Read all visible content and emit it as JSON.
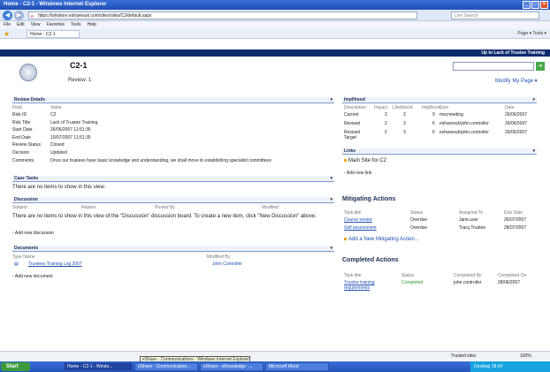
{
  "window": {
    "title": "Home - C2-1 - Windows Internet Explorer",
    "url": "https://ishistore.esharesuk.com/sites/risks/C2/default.aspx",
    "search_placeholder": "Live Search"
  },
  "menu": [
    "File",
    "Edit",
    "View",
    "Favorites",
    "Tools",
    "Help"
  ],
  "tab": {
    "label": "Home - C2-1"
  },
  "toolbar_right": "Page ▾  Tools ▾",
  "banner": "Up to Lack of Trustee Training",
  "page": {
    "title": "C2-1",
    "subtitle": "Review: 1",
    "modify": "Modify My Page ▾"
  },
  "review": {
    "title": "Review Details",
    "headers": [
      "Field",
      "Value"
    ],
    "rows": [
      [
        "Risk ID",
        "C2"
      ],
      [
        "Risk Title",
        "Lack of Trustee Training"
      ],
      [
        "Start Date",
        "26/06/2007 11:51:35"
      ],
      [
        "End Date",
        "10/07/2007 11:51:35"
      ],
      [
        "Review Status",
        "Closed"
      ],
      [
        "Decision",
        "Updated"
      ],
      [
        "Comments",
        "Once our trustees have basic knowledge and understanding, we shall move to establishing specialist committees"
      ]
    ]
  },
  "case": {
    "title": "Case Tasks",
    "empty": "There are no items to show in this view."
  },
  "discussion": {
    "title": "Discussion",
    "headers": [
      "Subject",
      "Replies",
      "Posted By",
      "Modified"
    ],
    "empty": "There are no items to show in this view of the \"Discussion\" discussion board. To create a new item, click \"New Discussion\" above.",
    "add": "Add new discussion"
  },
  "documents": {
    "title": "Documents",
    "headers": [
      "Type Name",
      "Modified By"
    ],
    "row": [
      "Trustees Training Log 2007",
      "John Controller"
    ],
    "add": "Add new document"
  },
  "imp": {
    "title": "Impllhood",
    "headers": [
      "Description",
      "Impact",
      "Likelihood",
      "Impllhood",
      "User",
      "Date"
    ],
    "rows": [
      [
        "Current",
        "3",
        "3",
        "9",
        "mscmeeting",
        "26/06/2007"
      ],
      [
        "Revised",
        "2",
        "3",
        "6",
        "esharesuk\\john.controller",
        "26/06/2007"
      ],
      [
        "Revised Target",
        "2",
        "3",
        "6",
        "esharesuk\\john.controller",
        "26/06/2007"
      ]
    ]
  },
  "links": {
    "title": "Links",
    "item": "Main Site for C2",
    "add": "Add new link"
  },
  "mit": {
    "title": "Mitigating Actions",
    "headers": [
      "Task title",
      "Status",
      "Assigned To",
      "Due Date"
    ],
    "rows": [
      [
        "Course review",
        "Overdue",
        "Jane.user",
        "26/07/2007"
      ],
      [
        "Self assessment",
        "Overdue",
        "Tracy.Trustee",
        "28/07/2007"
      ]
    ],
    "add": "Add a New Mitigating Action..."
  },
  "comp": {
    "title": "Completed Actions",
    "headers": [
      "Task title",
      "Status",
      "Completed By",
      "Completed On"
    ],
    "rows": [
      [
        "Trustee training requirements",
        "Completed",
        "john.controller",
        "28/06/2007"
      ]
    ]
  },
  "statusbar": {
    "zone": "Trusted sites",
    "zoom": "100%"
  },
  "tooltip": "eShare - Communications - Windows Internet Explorer",
  "taskbar": {
    "start": "Start",
    "items": [
      "Home - C2-1 - Windo...",
      "eShare - Communication...",
      "eShare - eKnowledge -...",
      "Microsoft Word"
    ],
    "tray": "Desktop  18:34"
  }
}
